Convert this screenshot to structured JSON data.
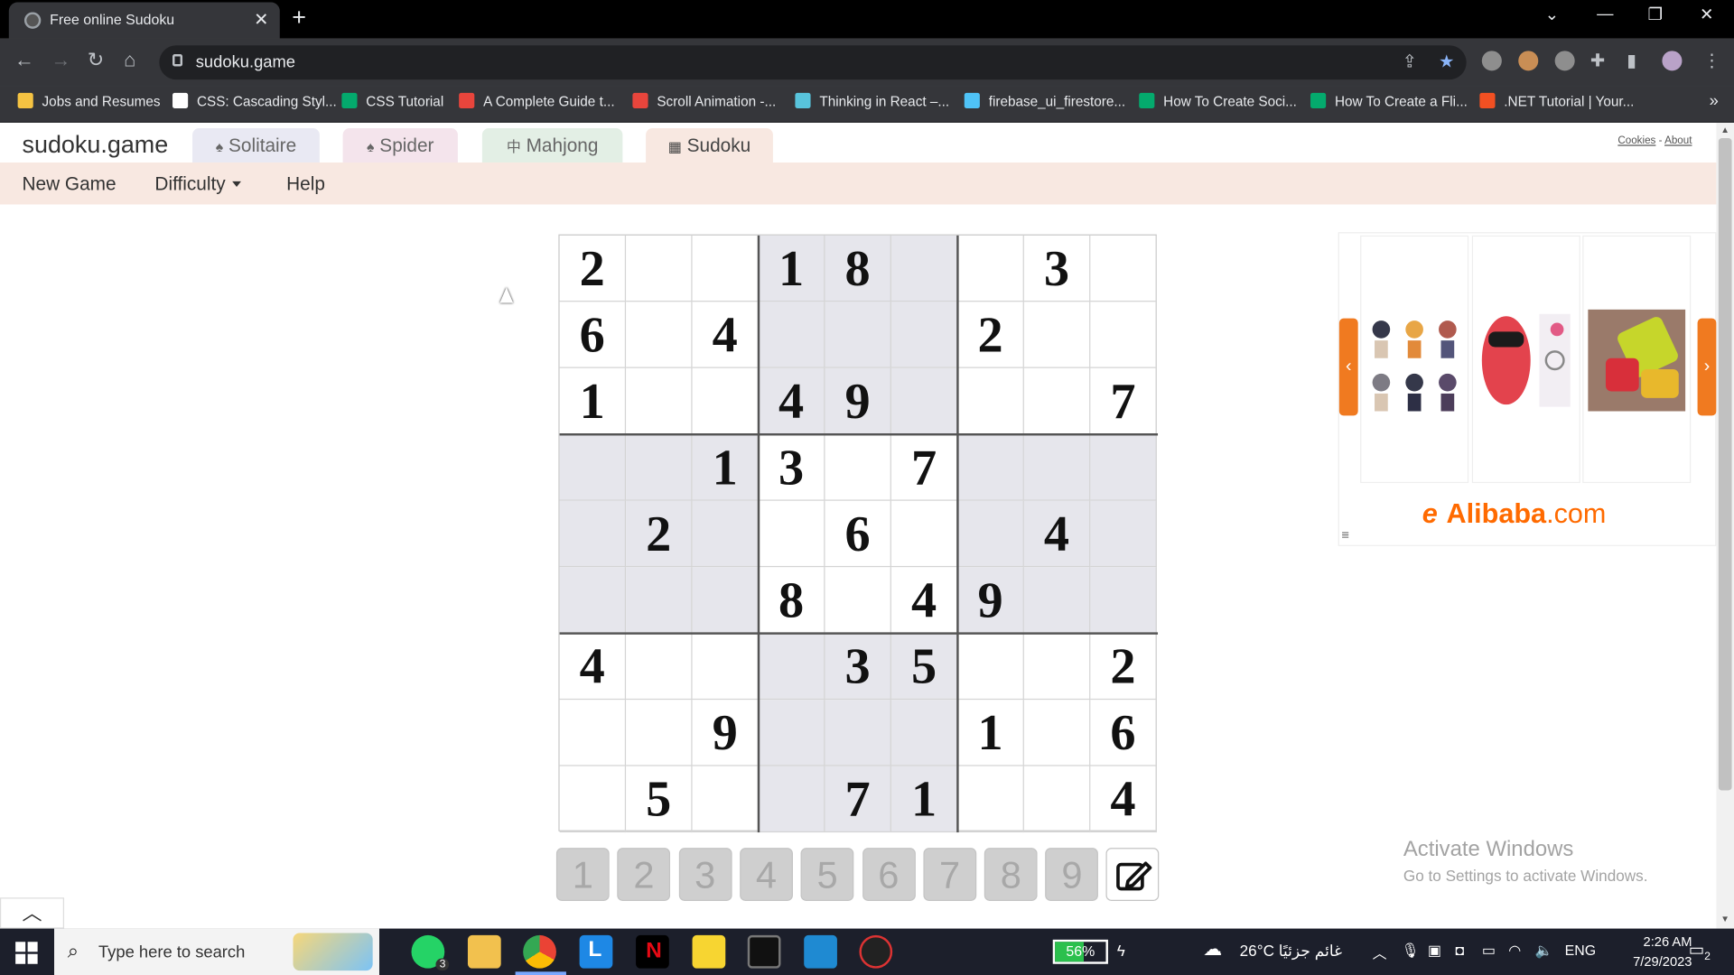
{
  "browser": {
    "tab_title": "Free online Sudoku",
    "url": "sudoku.game",
    "bookmarks": [
      {
        "label": "Jobs and Resumes",
        "icon": "folder-icon",
        "color": "#f5c342"
      },
      {
        "label": "CSS: Cascading Styl...",
        "icon": "mdn-icon",
        "color": "#ffffff"
      },
      {
        "label": "CSS Tutorial",
        "icon": "w3schools-icon",
        "color": "#04aa6d"
      },
      {
        "label": "A Complete Guide t...",
        "icon": "asterisk-icon",
        "color": "#e8453c"
      },
      {
        "label": "Scroll Animation -...",
        "icon": "asterisk-icon",
        "color": "#e8453c"
      },
      {
        "label": "Thinking in React –...",
        "icon": "react-icon",
        "color": "#58c4dc"
      },
      {
        "label": "firebase_ui_firestore...",
        "icon": "flutter-icon",
        "color": "#4fc3f7"
      },
      {
        "label": "How To Create Soci...",
        "icon": "w3schools-icon",
        "color": "#04aa6d"
      },
      {
        "label": "How To Create a Fli...",
        "icon": "w3schools-icon",
        "color": "#04aa6d"
      },
      {
        "label": ".NET Tutorial | Your...",
        "icon": "microsoft-icon",
        "color": "#f25022"
      }
    ],
    "more_bookmarks": "»"
  },
  "site": {
    "logo": "sudoku.game",
    "game_tabs": [
      {
        "label": "Solitaire",
        "icon": "spade-icon",
        "glyph": "♠"
      },
      {
        "label": "Spider",
        "icon": "spade-icon",
        "glyph": "♠"
      },
      {
        "label": "Mahjong",
        "icon": "mahjong-icon",
        "glyph": "中"
      },
      {
        "label": "Sudoku",
        "icon": "grid-icon",
        "glyph": "▦"
      }
    ],
    "cookies": "Cookies",
    "separator": " - ",
    "about": "About",
    "menu": {
      "new_game": "New Game",
      "difficulty": "Difficulty",
      "help": "Help"
    }
  },
  "board": {
    "rows": [
      [
        "2",
        "",
        "",
        "1",
        "8",
        "",
        "",
        "3",
        ""
      ],
      [
        "6",
        "",
        "4",
        "",
        "",
        "",
        "2",
        "",
        ""
      ],
      [
        "1",
        "",
        "",
        "4",
        "9",
        "",
        "",
        "",
        "7"
      ],
      [
        "",
        "",
        "1",
        "3",
        "",
        "7",
        "",
        "",
        ""
      ],
      [
        "",
        "2",
        "",
        "",
        "6",
        "",
        "",
        "4",
        ""
      ],
      [
        "",
        "",
        "",
        "8",
        "",
        "4",
        "9",
        "",
        ""
      ],
      [
        "4",
        "",
        "",
        "",
        "3",
        "5",
        "",
        "",
        "2"
      ],
      [
        "",
        "",
        "9",
        "",
        "",
        "",
        "1",
        "",
        "6"
      ],
      [
        "",
        "5",
        "",
        "",
        "7",
        "1",
        "",
        "",
        "4"
      ]
    ],
    "shaded_boxes": [
      1,
      3,
      5,
      7
    ]
  },
  "numpad": [
    "1",
    "2",
    "3",
    "4",
    "5",
    "6",
    "7",
    "8",
    "9"
  ],
  "ad": {
    "brand": "Alibaba",
    "brand_suffix": ".com",
    "brand_color": "#ff6a00"
  },
  "watermark": {
    "line1": "Activate Windows",
    "line2": "Go to Settings to activate Windows."
  },
  "taskbar": {
    "search_placeholder": "Type here to search",
    "battery": "56%",
    "battery_level": 0.56,
    "weather": "26°C  غائم جزئيًا",
    "lang": "ENG",
    "time": "2:26 AM",
    "date": "7/29/2023",
    "notifications": "2",
    "whatsapp_badge": "3"
  }
}
